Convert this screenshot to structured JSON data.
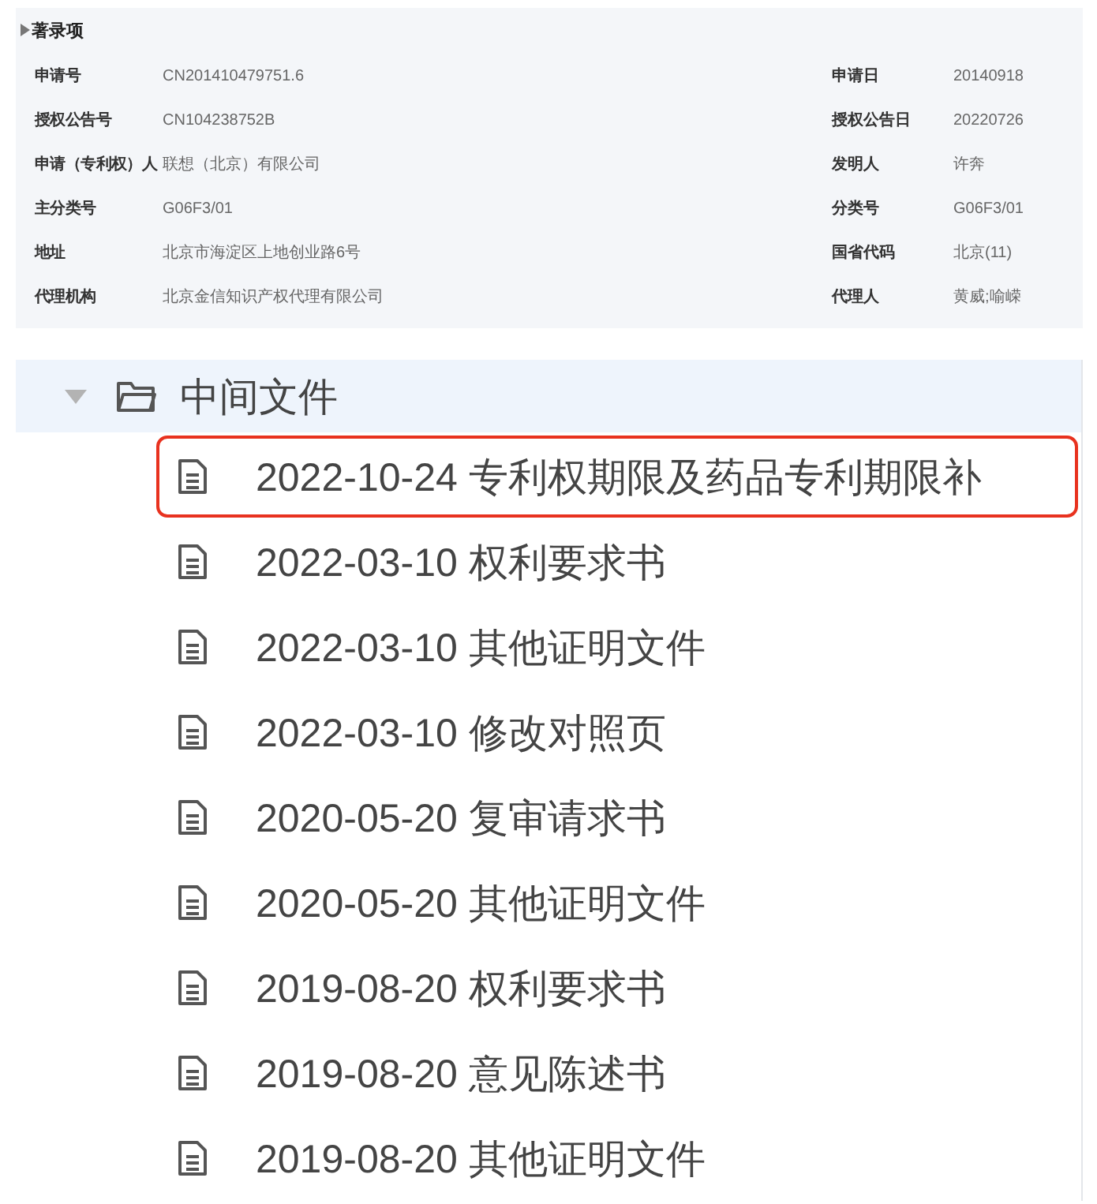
{
  "bibliography": {
    "title": "著录项",
    "expanded": true,
    "left": [
      {
        "label": "申请号",
        "value": "CN201410479751.6"
      },
      {
        "label": "授权公告号",
        "value": "CN104238752B"
      },
      {
        "label": "申请（专利权）人",
        "value": "联想（北京）有限公司"
      },
      {
        "label": "主分类号",
        "value": "G06F3/01"
      },
      {
        "label": "地址",
        "value": "北京市海淀区上地创业路6号"
      },
      {
        "label": "代理机构",
        "value": "北京金信知识产权代理有限公司"
      }
    ],
    "right": [
      {
        "label": "申请日",
        "value": "20140918"
      },
      {
        "label": "授权公告日",
        "value": "20220726"
      },
      {
        "label": "发明人",
        "value": "许奔"
      },
      {
        "label": "分类号",
        "value": "G06F3/01"
      },
      {
        "label": "国省代码",
        "value": "北京(11)"
      },
      {
        "label": "代理人",
        "value": "黄威;喻嵘"
      }
    ]
  },
  "tree": {
    "folder": {
      "label": "中间文件",
      "expanded": true,
      "children": [
        {
          "label": "2022-10-24 专利权期限及药品专利期限补",
          "highlighted": true
        },
        {
          "label": "2022-03-10 权利要求书",
          "highlighted": false
        },
        {
          "label": "2022-03-10 其他证明文件",
          "highlighted": false
        },
        {
          "label": "2022-03-10 修改对照页",
          "highlighted": false
        },
        {
          "label": "2020-05-20 复审请求书",
          "highlighted": false
        },
        {
          "label": "2020-05-20 其他证明文件",
          "highlighted": false
        },
        {
          "label": "2019-08-20 权利要求书",
          "highlighted": false
        },
        {
          "label": "2019-08-20 意见陈述书",
          "highlighted": false
        },
        {
          "label": "2019-08-20 其他证明文件",
          "highlighted": false
        }
      ]
    }
  }
}
